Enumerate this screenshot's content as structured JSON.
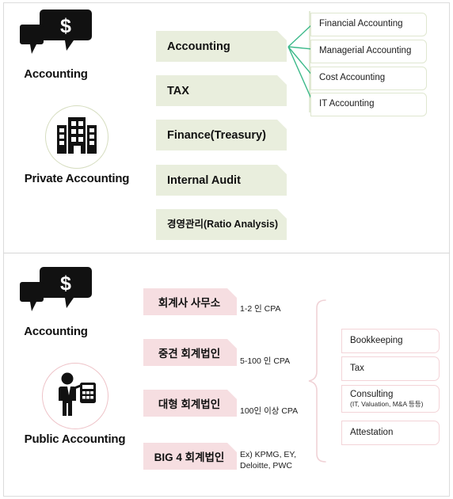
{
  "top_section": {
    "left_labels": [
      {
        "icon": "chat-dollar-icon",
        "caption": "Accounting"
      },
      {
        "icon": "office-buildings-icon",
        "caption": "Private Accounting"
      }
    ],
    "categories": [
      {
        "label": "Accounting"
      },
      {
        "label": "TAX"
      },
      {
        "label": "Finance(Treasury)"
      },
      {
        "label": "Internal Audit"
      },
      {
        "label": "경영관리(Ratio Analysis)"
      }
    ],
    "accounting_branches": [
      {
        "label": "Financial Accounting"
      },
      {
        "label": "Managerial Accounting"
      },
      {
        "label": "Cost Accounting"
      },
      {
        "label": "IT Accounting"
      }
    ]
  },
  "bottom_section": {
    "left_labels": [
      {
        "icon": "chat-dollar-icon",
        "caption": "Accounting"
      },
      {
        "icon": "accountant-person-calculator-icon",
        "caption": "Public Accounting"
      }
    ],
    "firm_tiers": [
      {
        "label": "회계사 사무소",
        "note": "1-2 인 CPA"
      },
      {
        "label": "중견 회계법인",
        "note": "5-100 인 CPA"
      },
      {
        "label": "대형 회계법인",
        "note": "100인 이상 CPA"
      },
      {
        "label": "BIG 4 회계법인",
        "note": "Ex) KPMG, EY,\nDeloitte, PWC"
      }
    ],
    "services": [
      {
        "title": "Bookkeeping",
        "subtitle": ""
      },
      {
        "title": "Tax",
        "subtitle": ""
      },
      {
        "title": "Consulting",
        "subtitle": "(IT, Valuation, M&A 등등)"
      },
      {
        "title": "Attestation",
        "subtitle": ""
      }
    ]
  },
  "colors": {
    "green_fill": "#e9eedd",
    "green_border": "#dfe7d0",
    "green_connector": "#3cb98a",
    "pink_fill": "#f6dee1",
    "pink_border": "#f3d4d8",
    "pink_circle": "#eec3c8",
    "green_circle": "#d6ddc0",
    "frame_border": "#dcdcdc",
    "text": "#111111"
  }
}
